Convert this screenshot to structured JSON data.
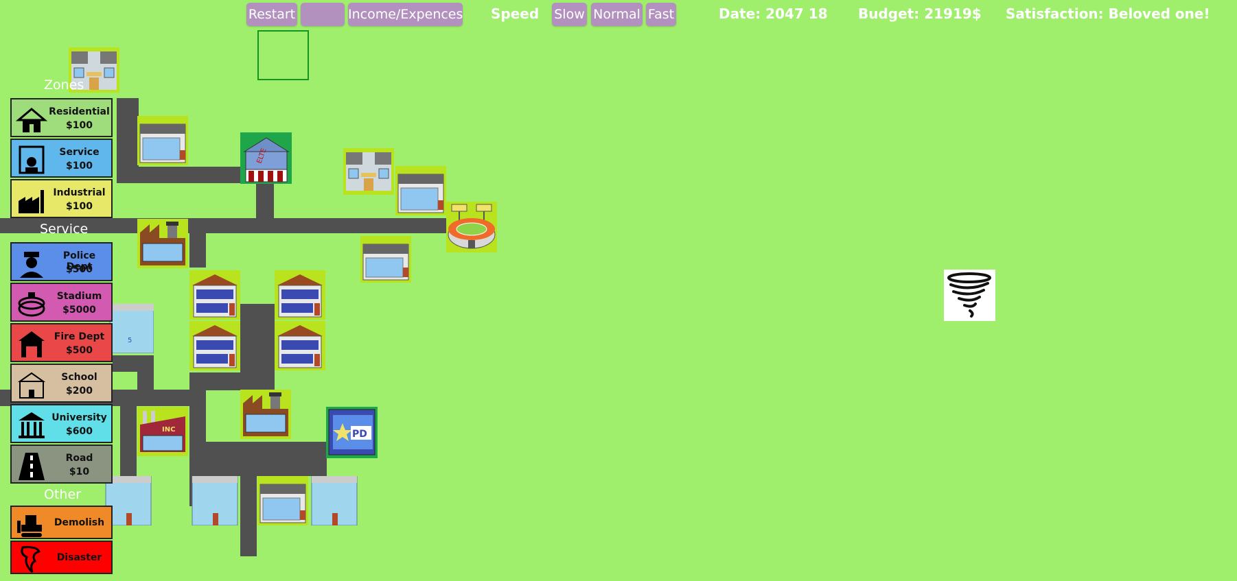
{
  "toolbar": {
    "restart": "Restart",
    "hidden_button": "",
    "income_expences": "Income/Expences",
    "speed_label": "Speed",
    "slow": "Slow",
    "normal": "Normal",
    "fast": "Fast"
  },
  "status": {
    "date": "Date: 2047 18",
    "budget": "Budget: 21919$",
    "satisfaction": "Satisfaction: Beloved one!"
  },
  "sections": {
    "zones": "Zones",
    "service": "Service",
    "other": "Other"
  },
  "tools": {
    "residential": {
      "name": "Residential",
      "price": "$100",
      "color": "#9fdc7c"
    },
    "service": {
      "name": "Service",
      "price": "$100",
      "color": "#5fb7ec"
    },
    "industrial": {
      "name": "Industrial",
      "price": "$100",
      "color": "#e8e868"
    },
    "police": {
      "name": "Police Dept",
      "price": "$500",
      "color": "#5b8ee8"
    },
    "stadium": {
      "name": "Stadium",
      "price": "$5000",
      "color": "#d25ab0"
    },
    "fire": {
      "name": "Fire Dept",
      "price": "$500",
      "color": "#ea4848"
    },
    "school": {
      "name": "School",
      "price": "$200",
      "color": "#d5bfa0"
    },
    "university": {
      "name": "University",
      "price": "$600",
      "color": "#60dfe9"
    },
    "road": {
      "name": "Road",
      "price": "$10",
      "color": "#8a9480"
    },
    "demolish": {
      "name": "Demolish",
      "color": "#f08a28"
    },
    "disaster": {
      "name": "Disaster",
      "color": "#ff0000"
    }
  },
  "map": {
    "building_labels": {
      "elite": "ELTE",
      "inc": "INC",
      "police": "PD",
      "school": "5",
      "shop": "5"
    }
  }
}
